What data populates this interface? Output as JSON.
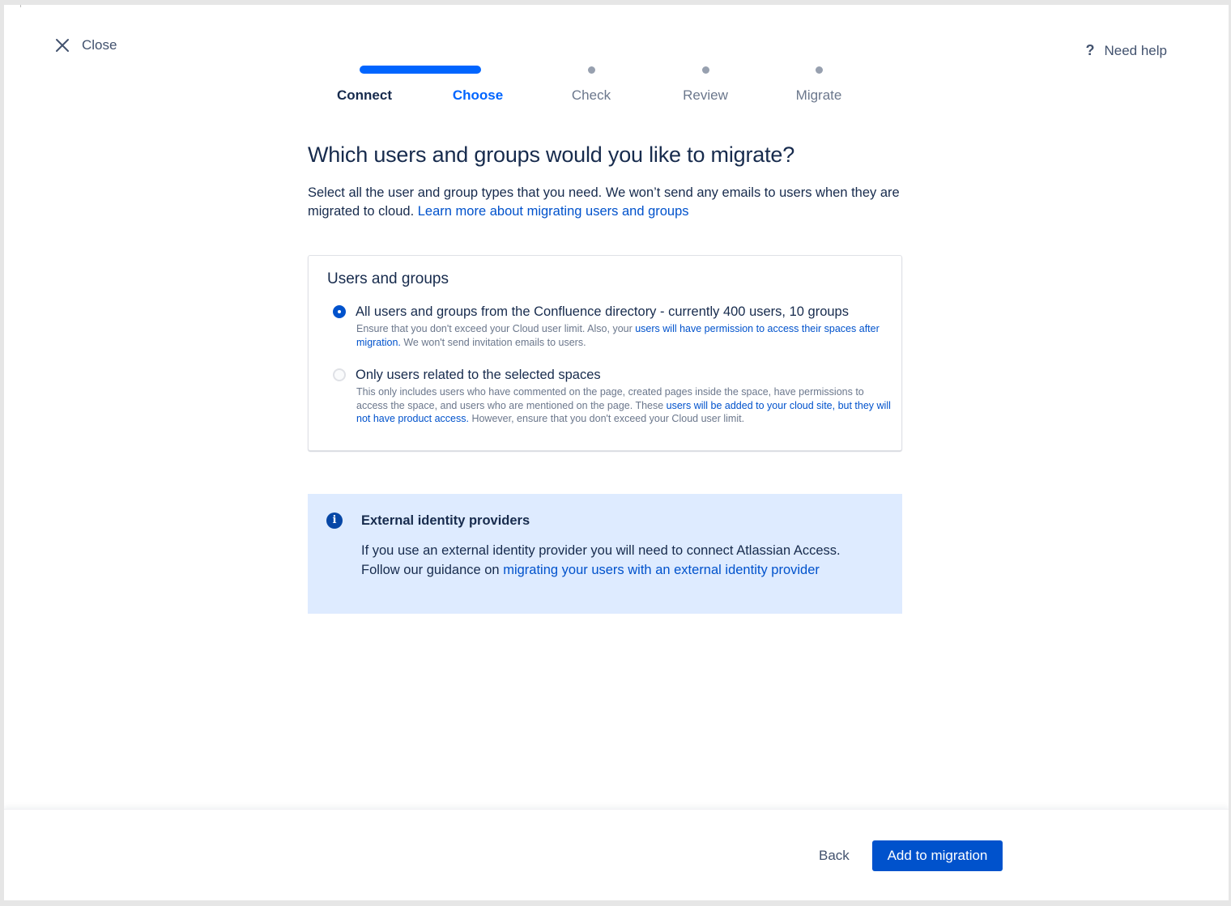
{
  "header": {
    "close_label": "Close",
    "help_label": "Need help",
    "help_icon_glyph": "?"
  },
  "steps": [
    {
      "label": "Connect",
      "state": "done"
    },
    {
      "label": "Choose",
      "state": "current"
    },
    {
      "label": "Check",
      "state": "upcoming"
    },
    {
      "label": "Review",
      "state": "upcoming"
    },
    {
      "label": "Migrate",
      "state": "upcoming"
    }
  ],
  "main": {
    "title": "Which users and groups would you like to migrate?",
    "intro_text": "Select all the user and group types that you need. We won’t send any emails to users when they are migrated to cloud. ",
    "intro_link": "Learn more about migrating users and groups"
  },
  "card": {
    "title": "Users and groups",
    "options": [
      {
        "title": "All users and groups from the Confluence directory - currently 400 users, 10 groups",
        "desc_pre": "Ensure that you don't exceed your Cloud user limit. Also, your ",
        "desc_link": "users will have permission to access their spaces after migration.",
        "desc_post": " We won't send invitation emails to users.",
        "selected": true
      },
      {
        "title": "Only users related to the selected spaces",
        "desc_pre": "This only includes users who have commented on the page, created pages inside the space, have permissions to access the space, and users who are mentioned on the page. These ",
        "desc_link": "users will be added to your cloud site, but they will not have product access.",
        "desc_post": " However, ensure that you don't exceed your Cloud user limit.",
        "selected": false
      }
    ]
  },
  "info": {
    "icon_glyph": "i",
    "title": "External identity providers",
    "body_pre": "If you use an external identity provider you will need to connect Atlassian Access. Follow our guidance on ",
    "body_link": "migrating your users with an external identity provider"
  },
  "footer": {
    "back_label": "Back",
    "primary_label": "Add to migration"
  },
  "colors": {
    "brand_blue": "#0052cc",
    "progress_blue": "#0065ff",
    "info_background": "#deebff",
    "text_primary": "#172b4d",
    "text_subtle": "#6b778c"
  }
}
